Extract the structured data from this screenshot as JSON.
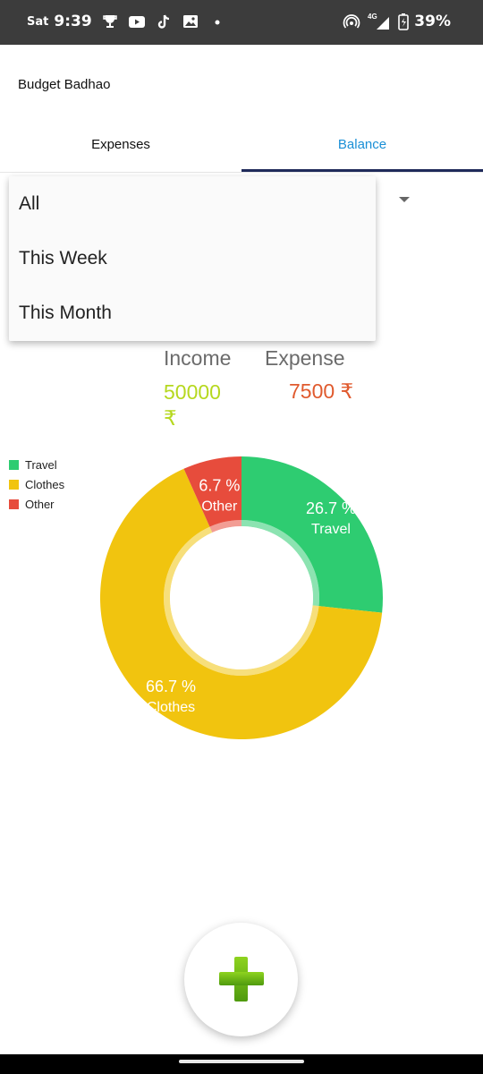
{
  "status_bar": {
    "day": "Sat",
    "time": "9:39",
    "network": "4G",
    "battery": "39%",
    "icons": [
      "trophy-icon",
      "youtube-icon",
      "tiktok-icon",
      "gallery-icon",
      "dot-icon",
      "hotspot-icon",
      "signal-icon",
      "battery-icon"
    ]
  },
  "app_bar": {
    "title": "Budget Badhao"
  },
  "tabs": [
    {
      "label": "Expenses",
      "selected": false
    },
    {
      "label": "Balance",
      "selected": true
    }
  ],
  "filter_dropdown": {
    "options": [
      "All",
      "This Week",
      "This Month"
    ]
  },
  "summary": {
    "income_label": "Income",
    "income_value": "50000 ₹",
    "expense_label": "Expense",
    "expense_value": "7500 ₹"
  },
  "legend": [
    {
      "label": "Travel",
      "color": "#2ecc71"
    },
    {
      "label": "Clothes",
      "color": "#f1c40f"
    },
    {
      "label": "Other",
      "color": "#e74c3c"
    }
  ],
  "chart_data": {
    "type": "pie",
    "donut": true,
    "legend_position": "top-left",
    "categories": [
      "Travel",
      "Clothes",
      "Other"
    ],
    "values": [
      26.7,
      66.7,
      6.7
    ],
    "value_labels": [
      "26.7 %",
      "66.7 %",
      "6.7 %"
    ],
    "colors": [
      "#2ecc71",
      "#f1c40f",
      "#e74c3c"
    ]
  },
  "colors": {
    "accent": "#1a8fd6",
    "tab_indicator": "#1f2a5a",
    "income": "#b6d81f",
    "expense": "#e05a2e"
  },
  "fab": {
    "icon": "plus-icon"
  }
}
